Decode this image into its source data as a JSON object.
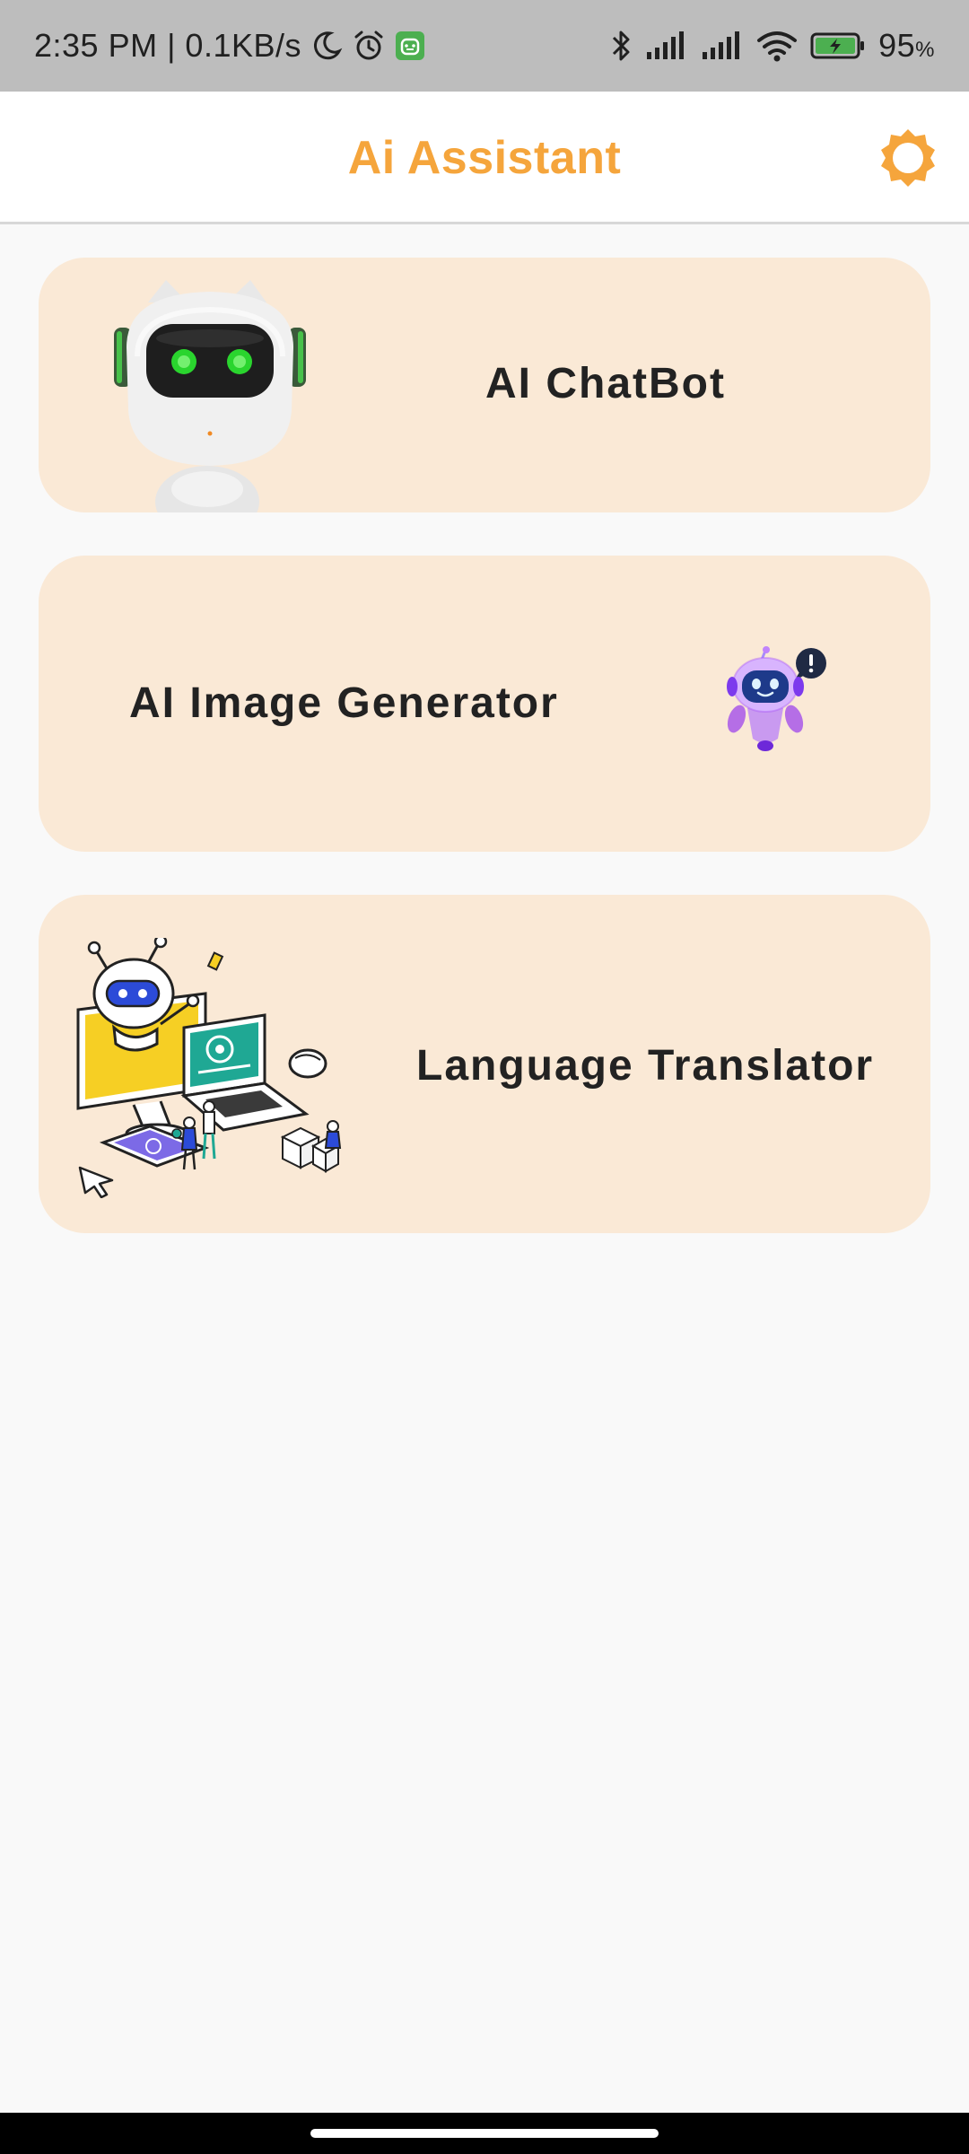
{
  "status_bar": {
    "time_and_speed": "2:35 PM | 0.1KB/s",
    "battery_percent": "95",
    "battery_suffix": "%",
    "icons": [
      "moon-icon",
      "alarm-icon",
      "android-app-icon",
      "bluetooth-icon",
      "signal-icon",
      "signal-icon",
      "wifi-icon",
      "battery-charging-icon"
    ]
  },
  "app_bar": {
    "title": "Ai Assistant",
    "settings_icon": "sun-gear-icon",
    "accent_color": "#f5a53c"
  },
  "cards": [
    {
      "label": "AI ChatBot",
      "image": "robot-head-illustration"
    },
    {
      "label": "AI Image Generator",
      "image": "purple-robot-illustration"
    },
    {
      "label": "Language Translator",
      "image": "devices-robot-illustration"
    }
  ],
  "colors": {
    "card_background": "#fae9d6",
    "page_background": "#f9f9f9",
    "status_bar_background": "#bdbdbd"
  }
}
